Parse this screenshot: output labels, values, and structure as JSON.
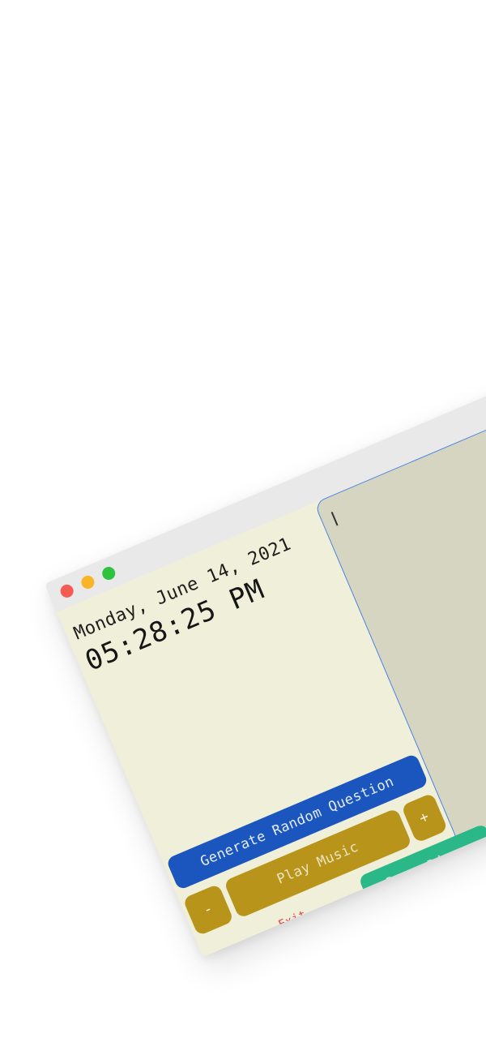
{
  "window": {
    "traffic_lights": {
      "close_color": "#f45b55",
      "minimize_color": "#f8b52a",
      "maximize_color": "#2fc23f"
    }
  },
  "clock": {
    "date": "Monday, June 14, 2021",
    "time": "05:28:25 PM"
  },
  "editor": {
    "value": ""
  },
  "controls": {
    "generate_question_label": "Generate Random Question",
    "volume_down_label": "-",
    "play_music_label": "Play Music",
    "volume_up_label": "+",
    "save_diary_label": "Save Diary",
    "exit_label": "Exit"
  },
  "colors": {
    "background": "#f0efd9",
    "editor_background": "#d6d5c1",
    "editor_border": "#4a85e6",
    "generate_button": "#1b56bf",
    "music_buttons": "#b8951a",
    "save_button": "#2ab888",
    "exit_text": "#e04141"
  }
}
